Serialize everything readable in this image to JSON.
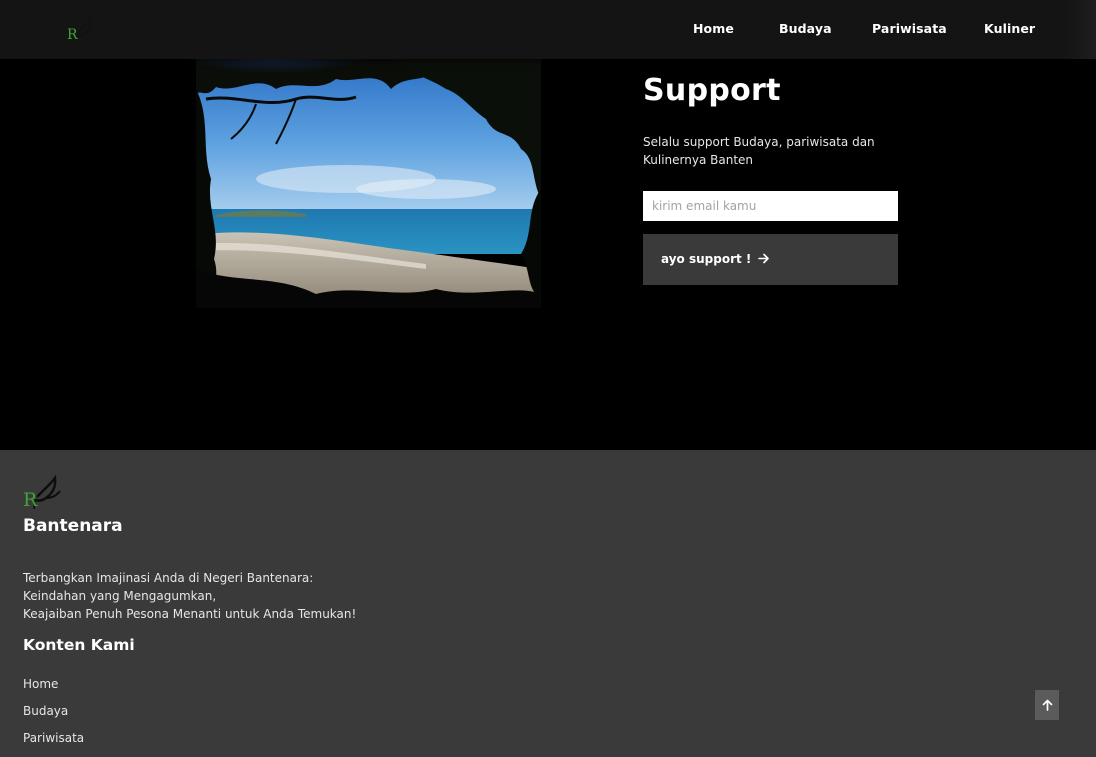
{
  "header": {
    "logo_icon": "bantenara-bird-logo-icon",
    "nav": [
      {
        "label": "Home"
      },
      {
        "label": "Budaya"
      },
      {
        "label": "Pariwisata"
      },
      {
        "label": "Kuliner"
      }
    ]
  },
  "support": {
    "title": "Support",
    "description": "Selalu support Budaya, pariwisata dan Kulinernya Banten",
    "email_placeholder": "kirim email kamu",
    "email_value": "",
    "button_label": "ayo support !",
    "button_icon": "arrow-right-icon"
  },
  "footer": {
    "brand": "Bantenara",
    "tagline": [
      "Terbangkan Imajinasi Anda di Negeri Bantenara:",
      "Keindahan yang Mengagumkan,",
      "Keajaiban Penuh Pesona Menanti untuk Anda Temukan!"
    ],
    "section_title": "Konten Kami",
    "links": [
      {
        "label": "Home"
      },
      {
        "label": "Budaya"
      },
      {
        "label": "Pariwisata"
      }
    ],
    "scroll_top_icon": "arrow-up-icon"
  },
  "colors": {
    "page_bg": "#000000",
    "header_bg": "#141414",
    "footer_bg": "#3a3a3a",
    "button_bg": "#3a3a3a",
    "logo_green": "#3fa535"
  }
}
